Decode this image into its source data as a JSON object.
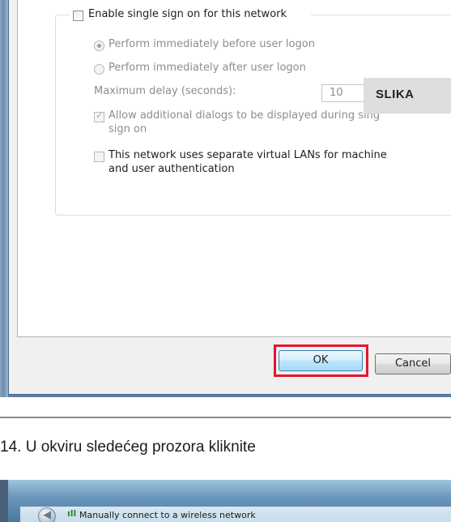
{
  "dialog": {
    "sso_label": "Enable single sign on for this network",
    "radio_before": "Perform immediately before user logon",
    "radio_after": "Perform immediately after user logon",
    "max_delay_label": "Maximum delay (seconds):",
    "max_delay_value": "10",
    "allow_dialogs_line1": "Allow additional dialogs to be displayed during sing",
    "allow_dialogs_line2": "sign on",
    "vlan_line1": "This network uses separate virtual LANs for machine",
    "vlan_line2": "and user authentication",
    "ok_label": "OK",
    "cancel_label": "Cancel"
  },
  "overlay_label": "SLIKA",
  "instruction_text": "14. U okviru sledećeg prozora kliknite",
  "second_window": {
    "title": "Manually connect to a wireless network"
  },
  "icons": {
    "radio": "radio-button",
    "checkbox": "checkbox",
    "back": "back-arrow-icon",
    "wifi": "wifi-icon"
  },
  "colors": {
    "highlight": "#e3172d",
    "frame_blue": "#5d7fa3",
    "dialog_bg": "#f0f0f0"
  }
}
